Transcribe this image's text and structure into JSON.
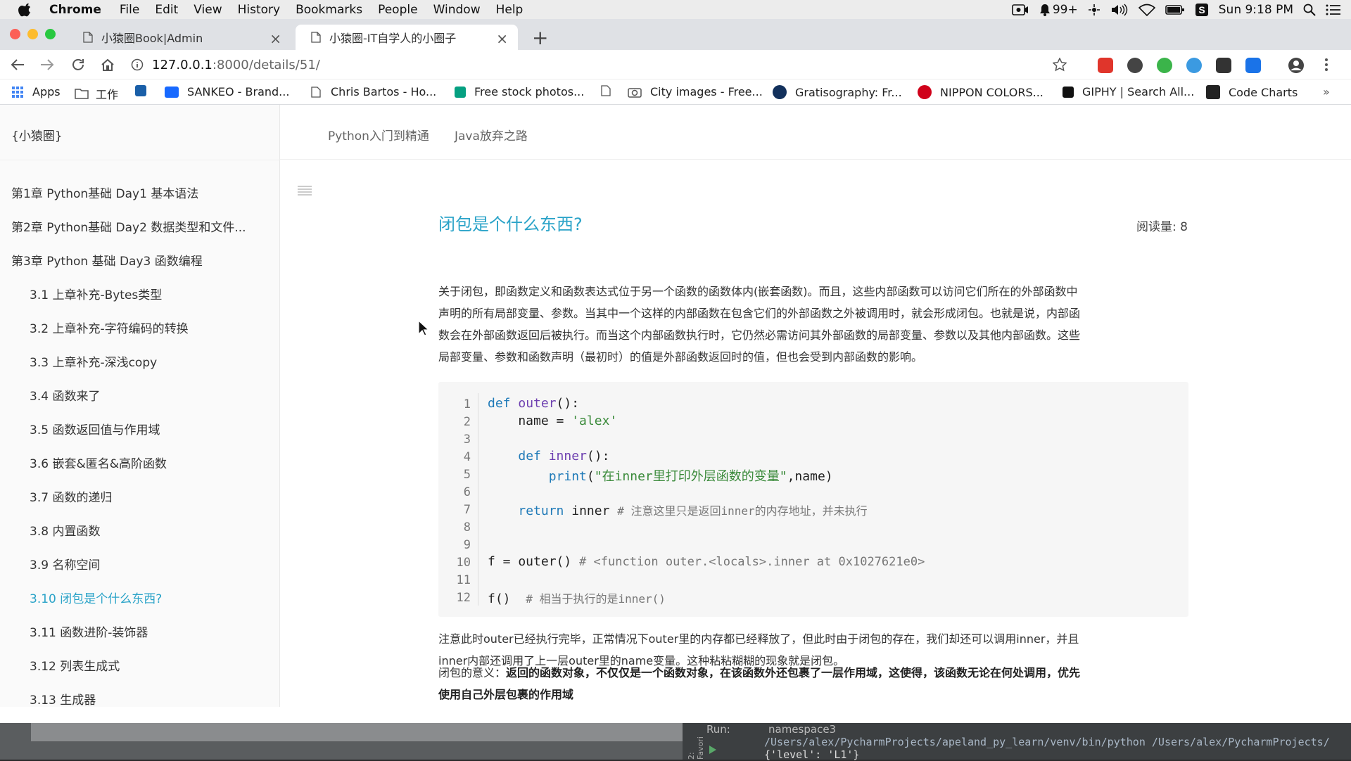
{
  "menubar": {
    "app": "Chrome",
    "items": [
      "File",
      "Edit",
      "View",
      "History",
      "Bookmarks",
      "People",
      "Window",
      "Help"
    ],
    "notif_count": "99+",
    "clock": "Sun 9:18 PM"
  },
  "tabs": [
    {
      "title": "小猿圈Book|Admin"
    },
    {
      "title": "小猿圈-IT自学人的小圈子"
    }
  ],
  "address": {
    "host": "127.0.0.1",
    "path": ":8000/details/51/"
  },
  "bookmarks": [
    {
      "label": "Apps",
      "icon": "apps-grid-icon"
    },
    {
      "label": "工作",
      "icon": "folder-icon"
    },
    {
      "label": "",
      "icon": "mail-icon"
    },
    {
      "label": "SANKEO - Brand...",
      "icon": "behance-icon"
    },
    {
      "label": "Chris Bartos - Ho...",
      "icon": "page-icon"
    },
    {
      "label": "Free stock photos...",
      "icon": "pexels-icon"
    },
    {
      "label": "",
      "icon": "page-icon"
    },
    {
      "label": "City images - Free...",
      "icon": "camera-icon"
    },
    {
      "label": "Gratisography: Fr...",
      "icon": "gratisography-icon"
    },
    {
      "label": "NIPPON COLORS...",
      "icon": "nippon-colors-icon"
    },
    {
      "label": "GIPHY | Search All...",
      "icon": "giphy-icon"
    },
    {
      "label": "Code Charts",
      "icon": "code-charts-icon"
    }
  ],
  "sidebar": {
    "brand": "{小猿圈}",
    "items": [
      {
        "label": "第1章 Python基础 Day1 基本语法",
        "level": 0
      },
      {
        "label": "第2章 Python基础 Day2 数据类型和文件...",
        "level": 0
      },
      {
        "label": "第3章 Python 基础 Day3 函数编程",
        "level": 0
      },
      {
        "label": "3.1 上章补充-Bytes类型",
        "level": 1
      },
      {
        "label": "3.2 上章补充-字符编码的转换",
        "level": 1
      },
      {
        "label": "3.3 上章补充-深浅copy",
        "level": 1
      },
      {
        "label": "3.4 函数来了",
        "level": 1
      },
      {
        "label": "3.5 函数返回值与作用域",
        "level": 1
      },
      {
        "label": "3.6 嵌套&匿名&高阶函数",
        "level": 1
      },
      {
        "label": "3.7 函数的递归",
        "level": 1
      },
      {
        "label": "3.8 内置函数",
        "level": 1
      },
      {
        "label": "3.9 名称空间",
        "level": 1
      },
      {
        "label": "3.10 闭包是个什么东西?",
        "level": 1,
        "active": true
      },
      {
        "label": "3.11 函数进阶-装饰器",
        "level": 1
      },
      {
        "label": "3.12 列表生成式",
        "level": 1
      },
      {
        "label": "3.13 生成器",
        "level": 1
      }
    ]
  },
  "topnav": [
    "Python入门到精通",
    "Java放弃之路"
  ],
  "article": {
    "title": "闭包是个什么东西?",
    "reads": "阅读量: 8",
    "intro": [
      "关于闭包，即函数定义和函数表达式位于另一个函数的函数体内(嵌套函数)。而且，这些内部函数可以访问它们所在的外部函数中",
      "声明的所有局部变量、参数。当其中一个这样的内部函数在包含它们的外部函数之外被调用时，就会形成闭包。也就是说，内部函",
      "数会在外部函数返回后被执行。而当这个内部函数执行时，它仍然必需访问其外部函数的局部变量、参数以及其他内部函数。这些",
      "局部变量、参数和函数声明（最初时）的值是外部函数返回时的值，但也会受到内部函数的影响。"
    ],
    "code_lines": [
      "1",
      "2",
      "3",
      "4",
      "5",
      "6",
      "7",
      "8",
      "9",
      "10",
      "11",
      "12"
    ],
    "code": {
      "l1_kw": "def",
      "l1_fn": "outer",
      "l1_rest": "():",
      "l2": "    name = ",
      "l2_str": "'alex'",
      "l4_ind": "    ",
      "l4_kw": "def",
      "l4_fn": "inner",
      "l4_rest": "():",
      "l5_ind": "        ",
      "l5_fn": "print",
      "l5_open": "(",
      "l5_str": "\"在inner里打印外层函数的变量\"",
      "l5_rest": ",name)",
      "l7_ind": "    ",
      "l7_kw": "return",
      "l7_rest": " inner ",
      "l7_cm": "# 注意这里只是返回inner的内存地址，并未执行",
      "l10": "f = outer() ",
      "l10_cm": "# <function outer.<locals>.inner at 0x1027621e0>",
      "l12": "f()  ",
      "l12_cm": "# 相当于执行的是inner()"
    },
    "after": [
      "注意此时outer已经执行完毕，正常情况下outer里的内存都已经释放了，但此时由于闭包的存在，我们却还可以调用inner，并且",
      "inner内部还调用了上一层outer里的name变量。这种粘粘糊糊的现象就是闭包。"
    ],
    "meaning_label": "闭包的意义：",
    "meaning_bold_1": "返回的函数对象，不仅仅是一个函数对象，在该函数外还包裹了一层作用域，这使得，该函数无论在何处调用，优先",
    "meaning_bold_2": "使用自己外层包裹的作用域"
  },
  "ide": {
    "run_label": "Run:",
    "config": "namespace3",
    "path": "/Users/alex/PycharmProjects/apeland_py_learn/venv/bin/python /Users/alex/PycharmProjects/",
    "output": "{'level': 'L1'}",
    "side_tab": "2: Favori"
  },
  "colors": {
    "accent": "#2aa3c8",
    "keyword": "#1f7ab8",
    "string": "#3a8a3a"
  }
}
